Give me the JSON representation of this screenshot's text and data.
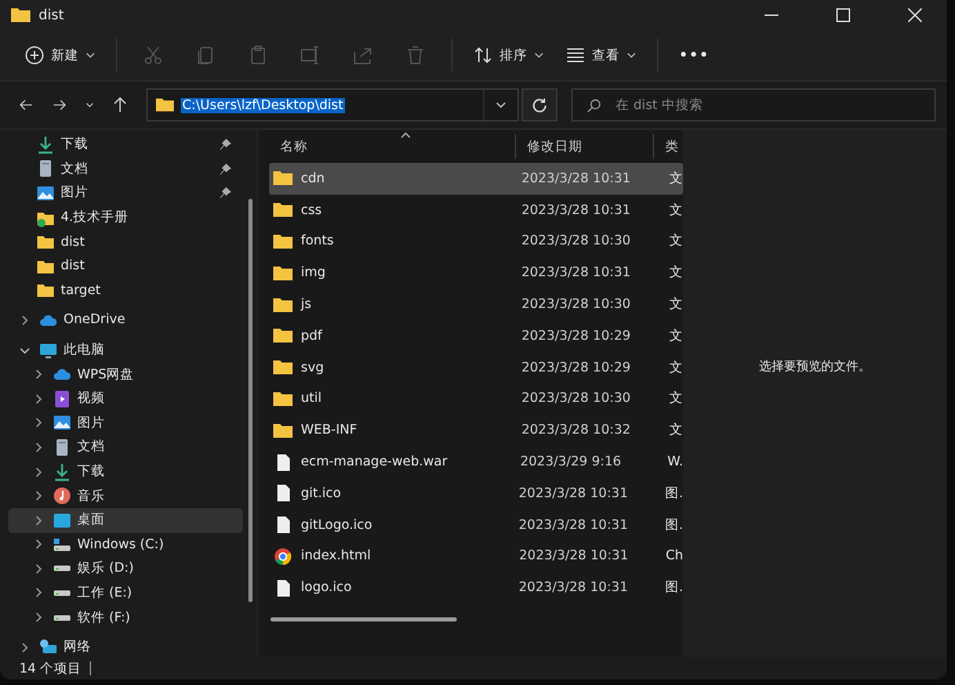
{
  "window": {
    "title": "dist"
  },
  "toolbar": {
    "new_label": "新建",
    "actions": [
      {
        "kind": "cut",
        "disabled": true
      },
      {
        "kind": "copy",
        "disabled": true
      },
      {
        "kind": "paste",
        "disabled": true
      },
      {
        "kind": "rename",
        "disabled": true
      },
      {
        "kind": "share",
        "disabled": true
      },
      {
        "kind": "delete",
        "disabled": true
      }
    ],
    "sort_label": "排序",
    "view_label": "查看",
    "more": "•••"
  },
  "address": {
    "path": "C:\\Users\\lzf\\Desktop\\dist",
    "search_placeholder": "在 dist 中搜索"
  },
  "quick_access": [
    {
      "label": "下载",
      "kind": "download",
      "pinned": true,
      "selected": false
    },
    {
      "label": "文档",
      "kind": "document",
      "pinned": true,
      "selected": false
    },
    {
      "label": "图片",
      "kind": "picture",
      "pinned": true,
      "selected": false
    },
    {
      "label": "4.技术手册",
      "kind": "synced-folder",
      "pinned": false,
      "selected": false
    },
    {
      "label": "dist",
      "kind": "folder",
      "pinned": false,
      "selected": false
    },
    {
      "label": "dist",
      "kind": "folder",
      "pinned": false,
      "selected": false
    },
    {
      "label": "target",
      "kind": "folder",
      "pinned": false,
      "selected": false
    }
  ],
  "nav": [
    {
      "label": "OneDrive",
      "kind": "cloud",
      "expanded": false,
      "selected": false
    },
    {
      "label": "此电脑",
      "kind": "pc",
      "expanded": true,
      "selected": false,
      "children": [
        {
          "label": "WPS网盘",
          "kind": "cloud",
          "expanded": false,
          "selected": false
        },
        {
          "label": "视频",
          "kind": "video",
          "expanded": false,
          "selected": false
        },
        {
          "label": "图片",
          "kind": "picture",
          "expanded": false,
          "selected": false
        },
        {
          "label": "文档",
          "kind": "document",
          "expanded": false,
          "selected": false
        },
        {
          "label": "下载",
          "kind": "download",
          "expanded": false,
          "selected": false
        },
        {
          "label": "音乐",
          "kind": "music",
          "expanded": false,
          "selected": false
        },
        {
          "label": "桌面",
          "kind": "desktop",
          "expanded": false,
          "selected": true
        },
        {
          "label": "Windows (C:)",
          "kind": "system-drive",
          "expanded": false,
          "selected": false
        },
        {
          "label": "娱乐 (D:)",
          "kind": "drive",
          "expanded": false,
          "selected": false
        },
        {
          "label": "工作 (E:)",
          "kind": "drive",
          "expanded": false,
          "selected": false
        },
        {
          "label": "软件 (F:)",
          "kind": "drive",
          "expanded": false,
          "selected": false
        }
      ]
    },
    {
      "label": "网络",
      "kind": "network",
      "expanded": false,
      "selected": false
    }
  ],
  "columns": [
    "名称",
    "修改日期",
    "类"
  ],
  "files": [
    {
      "name": "cdn",
      "kind": "folder",
      "date": "2023/3/28 10:31",
      "type": "文",
      "selected": true
    },
    {
      "name": "css",
      "kind": "folder",
      "date": "2023/3/28 10:31",
      "type": "文",
      "selected": false
    },
    {
      "name": "fonts",
      "kind": "folder",
      "date": "2023/3/28 10:30",
      "type": "文",
      "selected": false
    },
    {
      "name": "img",
      "kind": "folder",
      "date": "2023/3/28 10:31",
      "type": "文",
      "selected": false
    },
    {
      "name": "js",
      "kind": "folder",
      "date": "2023/3/28 10:30",
      "type": "文",
      "selected": false
    },
    {
      "name": "pdf",
      "kind": "folder",
      "date": "2023/3/28 10:29",
      "type": "文",
      "selected": false
    },
    {
      "name": "svg",
      "kind": "folder",
      "date": "2023/3/28 10:29",
      "type": "文",
      "selected": false
    },
    {
      "name": "util",
      "kind": "folder",
      "date": "2023/3/28 10:30",
      "type": "文",
      "selected": false
    },
    {
      "name": "WEB-INF",
      "kind": "folder",
      "date": "2023/3/28 10:32",
      "type": "文",
      "selected": false
    },
    {
      "name": "ecm-manage-web.war",
      "kind": "file",
      "date": "2023/3/29 9:16",
      "type": "W.",
      "selected": false
    },
    {
      "name": "git.ico",
      "kind": "file",
      "date": "2023/3/28 10:31",
      "type": "图.",
      "selected": false
    },
    {
      "name": "gitLogo.ico",
      "kind": "file",
      "date": "2023/3/28 10:31",
      "type": "图.",
      "selected": false
    },
    {
      "name": "index.html",
      "kind": "browser",
      "date": "2023/3/28 10:31",
      "type": "Ch",
      "selected": false
    },
    {
      "name": "logo.ico",
      "kind": "file",
      "date": "2023/3/28 10:31",
      "type": "图.",
      "selected": false
    }
  ],
  "preview": {
    "message": "选择要预览的文件。"
  },
  "status_bar": {
    "count": "14 个项目"
  }
}
